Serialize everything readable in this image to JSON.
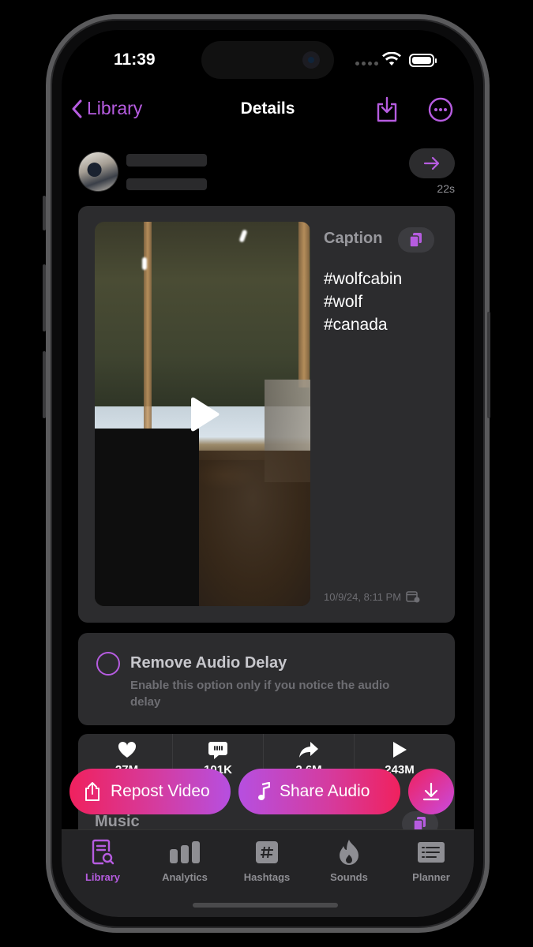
{
  "status_bar": {
    "time": "11:39"
  },
  "nav": {
    "back_label": "Library",
    "title": "Details"
  },
  "post": {
    "age": "22s"
  },
  "video": {
    "caption_label": "Caption",
    "caption_lines": [
      "#wolfcabin",
      "#wolf",
      "#canada"
    ],
    "date": "10/9/24, 8:11 PM"
  },
  "audio_delay": {
    "title": "Remove Audio Delay",
    "description": "Enable this option only if you notice the audio delay",
    "enabled": false
  },
  "stats": {
    "likes": "27M",
    "comments": "101K",
    "shares": "2.6M",
    "plays": "243M"
  },
  "music": {
    "label": "Music"
  },
  "actions": {
    "repost_label": "Repost Video",
    "share_audio_label": "Share Audio"
  },
  "tabbar": {
    "items": [
      {
        "label": "Library",
        "icon": "library-icon",
        "active": true
      },
      {
        "label": "Analytics",
        "icon": "bar-chart-icon",
        "active": false
      },
      {
        "label": "Hashtags",
        "icon": "hashtag-icon",
        "active": false
      },
      {
        "label": "Sounds",
        "icon": "flame-icon",
        "active": false
      },
      {
        "label": "Planner",
        "icon": "list-icon",
        "active": false
      }
    ]
  },
  "colors": {
    "accent": "#b65ce0",
    "gradient_pink": "#f0215e",
    "gradient_purple": "#b64fe0",
    "card_bg": "#2c2c2e"
  }
}
